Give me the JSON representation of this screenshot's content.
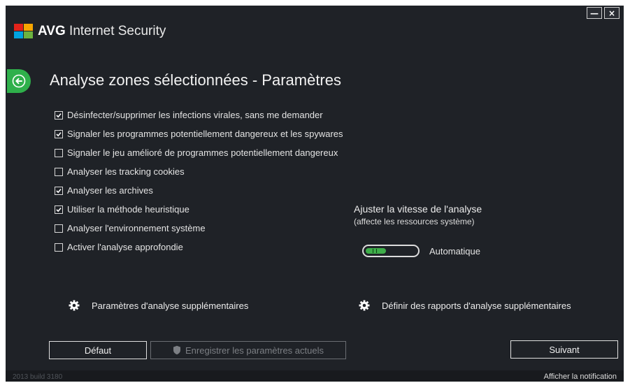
{
  "window": {
    "minimize_label": "—",
    "close_label": "×"
  },
  "app": {
    "brand": "AVG",
    "product": " Internet Security",
    "logo_colors": [
      "#e2231a",
      "#f7a600",
      "#00a3e0",
      "#6cb33f"
    ]
  },
  "page": {
    "back_icon": "back-arrow-icon",
    "title": "Analyse zones sélectionnées - Paramètres"
  },
  "options": [
    {
      "label": "Désinfecter/supprimer les infections virales, sans me demander",
      "checked": true
    },
    {
      "label": "Signaler les programmes potentiellement dangereux et les spywares",
      "checked": true
    },
    {
      "label": "Signaler le jeu amélioré de programmes potentiellement dangereux",
      "checked": false
    },
    {
      "label": "Analyser les tracking cookies",
      "checked": false
    },
    {
      "label": "Analyser les archives",
      "checked": true
    },
    {
      "label": "Utiliser la méthode heuristique",
      "checked": true
    },
    {
      "label": "Analyser l'environnement système",
      "checked": false
    },
    {
      "label": "Activer l'analyse approfondie",
      "checked": false
    }
  ],
  "speed": {
    "title": "Ajuster la vitesse de l'analyse",
    "subtitle": "(affecte les ressources système)",
    "value_label": "Automatique",
    "level": 0.4,
    "accent": "#3fae4a"
  },
  "more_settings": {
    "scan_params_label": "Paramètres d'analyse supplémentaires",
    "reports_label": "Définir des rapports d'analyse supplémentaires",
    "icon": "gear-icon"
  },
  "buttons": {
    "default_label": "Défaut",
    "save_label": "Enregistrer les paramètres actuels",
    "next_label": "Suivant"
  },
  "footer": {
    "version": "2013 build 3180",
    "notification_link": "Afficher la notification"
  }
}
